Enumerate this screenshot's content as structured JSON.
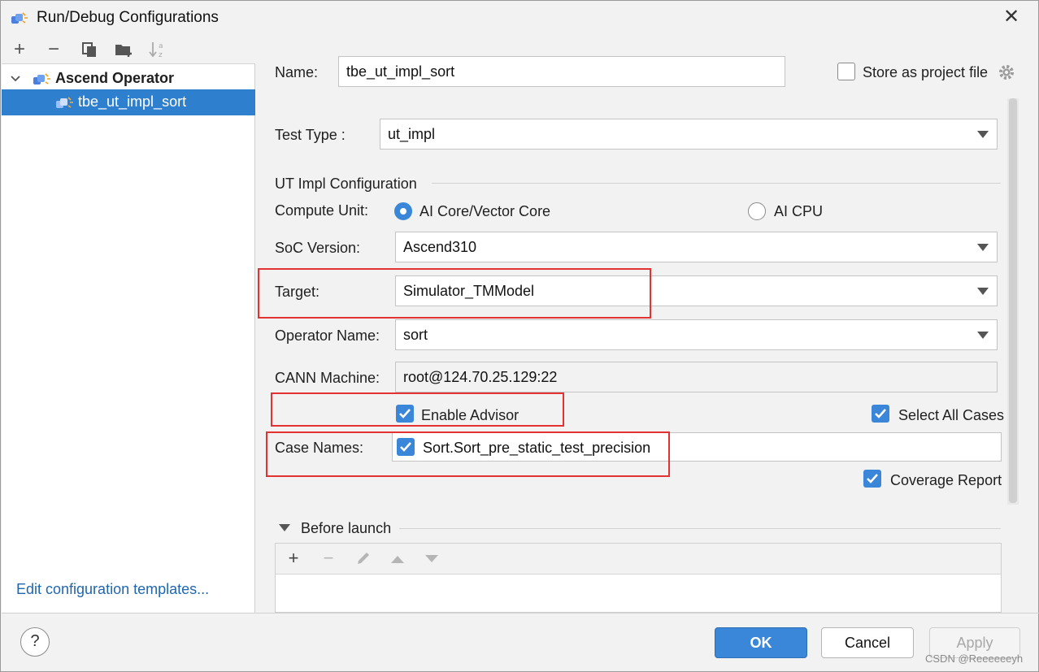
{
  "window": {
    "title": "Run/Debug Configurations",
    "close_glyph": "✕"
  },
  "left": {
    "toolbar": {
      "add": "+",
      "remove": "−",
      "copy": "copy-icon",
      "folder": "folder-add-icon",
      "sort": "sort-az-icon"
    },
    "tree": {
      "group_label": "Ascend Operator",
      "item_label": "tbe_ut_impl_sort"
    },
    "edit_templates": "Edit configuration templates..."
  },
  "form": {
    "name_label": "Name:",
    "name_value": "tbe_ut_impl_sort",
    "store_label": "Store as project file",
    "test_type_label": "Test Type :",
    "test_type_value": "ut_impl",
    "section_title": "UT Impl Configuration",
    "compute_unit_label": "Compute Unit:",
    "compute_option_1": "AI Core/Vector Core",
    "compute_option_2": "AI CPU",
    "soc_label": "SoC Version:",
    "soc_value": "Ascend310",
    "target_label": "Target:",
    "target_value": "Simulator_TMModel",
    "operator_label": "Operator Name:",
    "operator_value": "sort",
    "cann_label": "CANN Machine:",
    "cann_value": "root@124.70.25.129:22",
    "enable_advisor": "Enable Advisor",
    "select_all_cases": "Select All Cases",
    "case_names_label": "Case Names:",
    "case_name_value": "Sort.Sort_pre_static_test_precision",
    "coverage_report": "Coverage Report"
  },
  "before_launch": {
    "title": "Before launch",
    "add": "+",
    "remove": "−"
  },
  "buttons": {
    "help": "?",
    "ok": "OK",
    "cancel": "Cancel",
    "apply": "Apply"
  },
  "watermark": "CSDN @Reeeeeeyh",
  "colors": {
    "accent": "#3a87d9",
    "selection": "#2f7fcf",
    "highlight_box": "#e23232",
    "link": "#2166b0"
  }
}
